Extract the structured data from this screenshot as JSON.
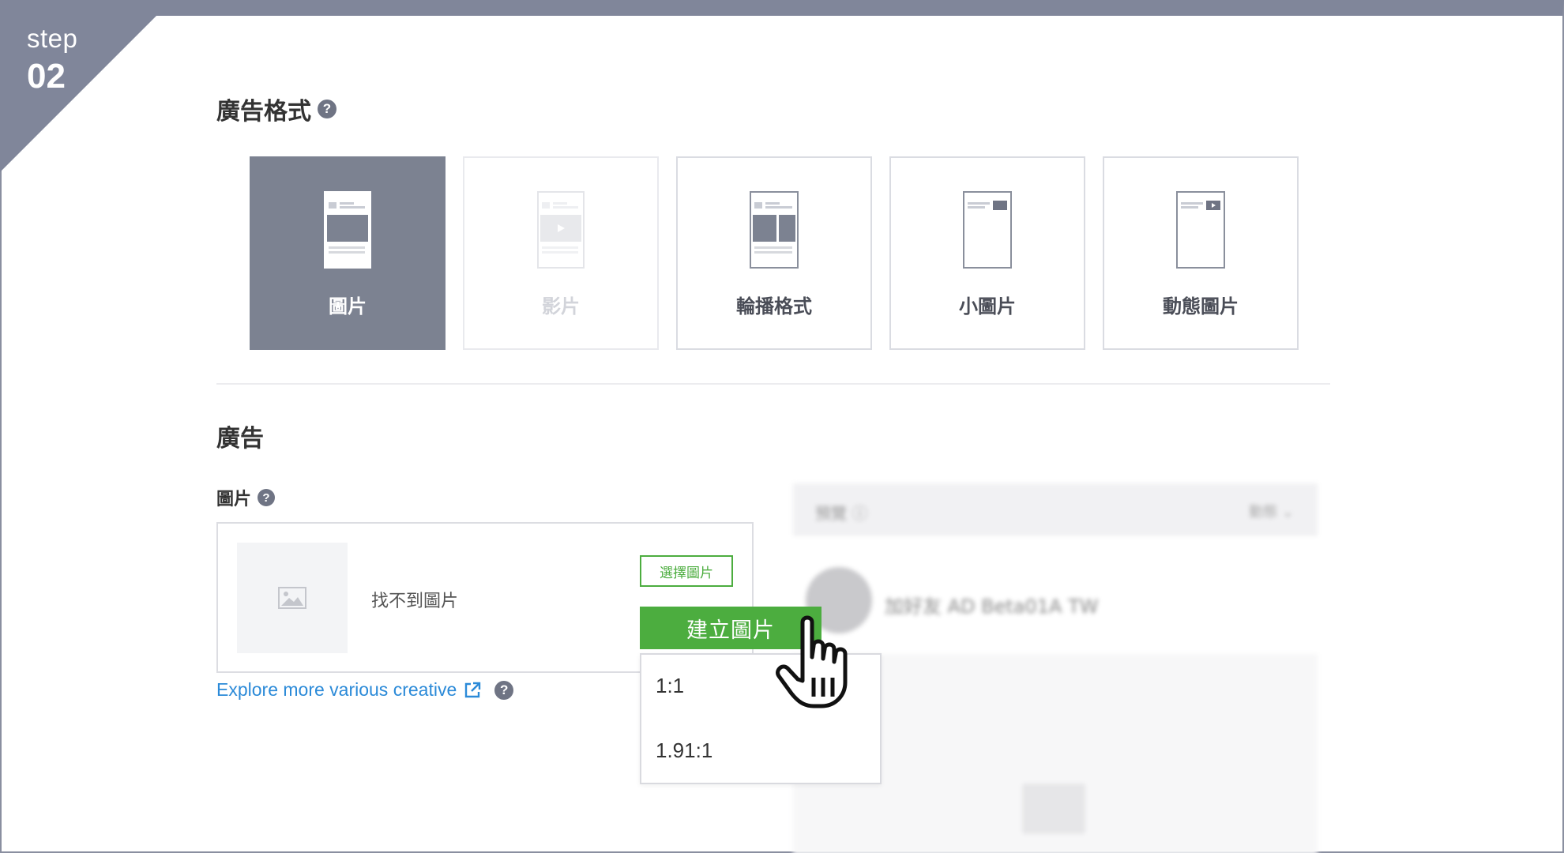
{
  "step": {
    "word": "step",
    "number": "02"
  },
  "format_section": {
    "title": "廣告格式",
    "cards": [
      {
        "label": "圖片",
        "state": "selected"
      },
      {
        "label": "影片",
        "state": "disabled"
      },
      {
        "label": "輪播格式",
        "state": "normal"
      },
      {
        "label": "小圖片",
        "state": "normal"
      },
      {
        "label": "動態圖片",
        "state": "normal"
      }
    ]
  },
  "ad_section": {
    "title": "廣告",
    "image_label": "圖片",
    "empty_text": "找不到圖片",
    "select_button": "選擇圖片",
    "create_button": "建立圖片",
    "ratio_options": [
      "1:1",
      "1.91:1"
    ],
    "explore_link": "Explore more various creative"
  },
  "preview": {
    "header": "預覽 ⓘ",
    "header_right": "動態 ⌄",
    "account_name": "加好友 AD Beta01A TW"
  },
  "colors": {
    "frame": "#80869a",
    "selected_card": "#7c8291",
    "green": "#4cad3f",
    "link": "#2b8ad8"
  },
  "icons": [
    "help-icon",
    "image-placeholder-icon",
    "external-link-icon",
    "pointing-hand-cursor-icon"
  ]
}
